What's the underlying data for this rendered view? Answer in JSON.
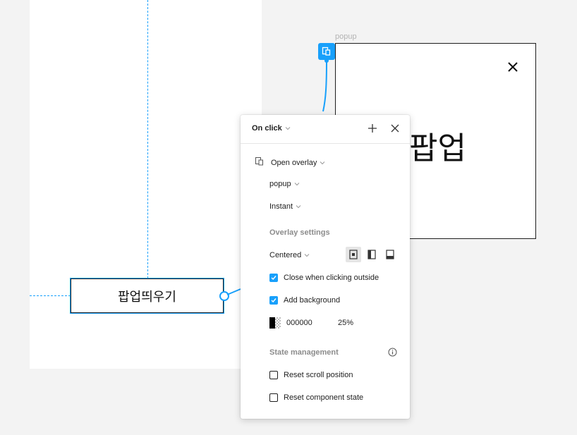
{
  "canvas": {
    "button_text": "팝업띄우기",
    "popup_frame_label": "popup",
    "popup_text": "팝업"
  },
  "panel": {
    "trigger": "On click",
    "action": "Open overlay",
    "destination": "popup",
    "animation": "Instant",
    "overlay_settings_title": "Overlay settings",
    "position": "Centered",
    "close_outside_label": "Close when clicking outside",
    "close_outside_checked": true,
    "add_background_label": "Add background",
    "add_background_checked": true,
    "background_hex": "000000",
    "background_opacity": "25%",
    "state_title": "State management",
    "reset_scroll_label": "Reset scroll position",
    "reset_scroll_checked": false,
    "reset_component_label": "Reset component state",
    "reset_component_checked": false
  },
  "colors": {
    "accent": "#18a0fb",
    "canvas_bg": "#f3f3f3"
  },
  "icons": [
    "overlay-icon",
    "chevron-down-icon",
    "plus-icon",
    "close-icon",
    "info-icon",
    "position-center-icon",
    "position-left-icon",
    "position-bottom-icon"
  ]
}
